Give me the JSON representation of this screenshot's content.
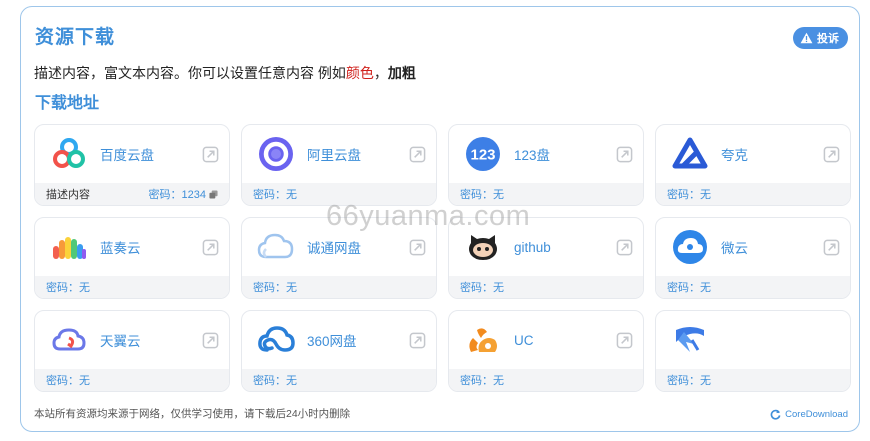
{
  "header": {
    "title": "资源下载",
    "report_label": "投诉",
    "desc_prefix": "描述内容，富文本内容。你可以设置任意内容 例如",
    "desc_red": "颜色",
    "desc_sep": "，",
    "desc_bold": "加粗",
    "subtitle": "下载地址"
  },
  "cards": [
    {
      "name": "百度云盘",
      "note": "描述内容",
      "password": "密码：1234",
      "icon": "baidu-cloud-icon",
      "copy_icon": true
    },
    {
      "name": "阿里云盘",
      "note": "",
      "password": "密码：无",
      "icon": "aliyun-drive-icon"
    },
    {
      "name": "123盘",
      "note": "",
      "password": "密码：无",
      "icon": "123pan-icon"
    },
    {
      "name": "夸克",
      "note": "",
      "password": "密码：无",
      "icon": "quark-icon"
    },
    {
      "name": "蓝奏云",
      "note": "",
      "password": "密码：无",
      "icon": "lanzou-cloud-icon"
    },
    {
      "name": "诚通网盘",
      "note": "",
      "password": "密码：无",
      "icon": "ctfile-cloud-icon"
    },
    {
      "name": "github",
      "note": "",
      "password": "密码：无",
      "icon": "github-icon"
    },
    {
      "name": "微云",
      "note": "",
      "password": "密码：无",
      "icon": "weiyun-icon"
    },
    {
      "name": "天翼云",
      "note": "",
      "password": "密码：无",
      "icon": "tianyi-cloud-icon"
    },
    {
      "name": "360网盘",
      "note": "",
      "password": "密码：无",
      "icon": "360-pan-icon"
    },
    {
      "name": "UC",
      "note": "",
      "password": "密码：无",
      "icon": "uc-icon"
    },
    {
      "name": "",
      "note": "",
      "password": "密码：无",
      "icon": "xunlei-icon"
    }
  ],
  "footer": {
    "note": "本站所有资源均来源于网络，仅供学习使用，请下载后24小时内删除",
    "brand": "CoreDownload"
  },
  "watermark": "66yuanma.com",
  "colors": {
    "accent": "#3f8fd9",
    "report_bg": "#4a90e2",
    "red": "#d0211c"
  }
}
